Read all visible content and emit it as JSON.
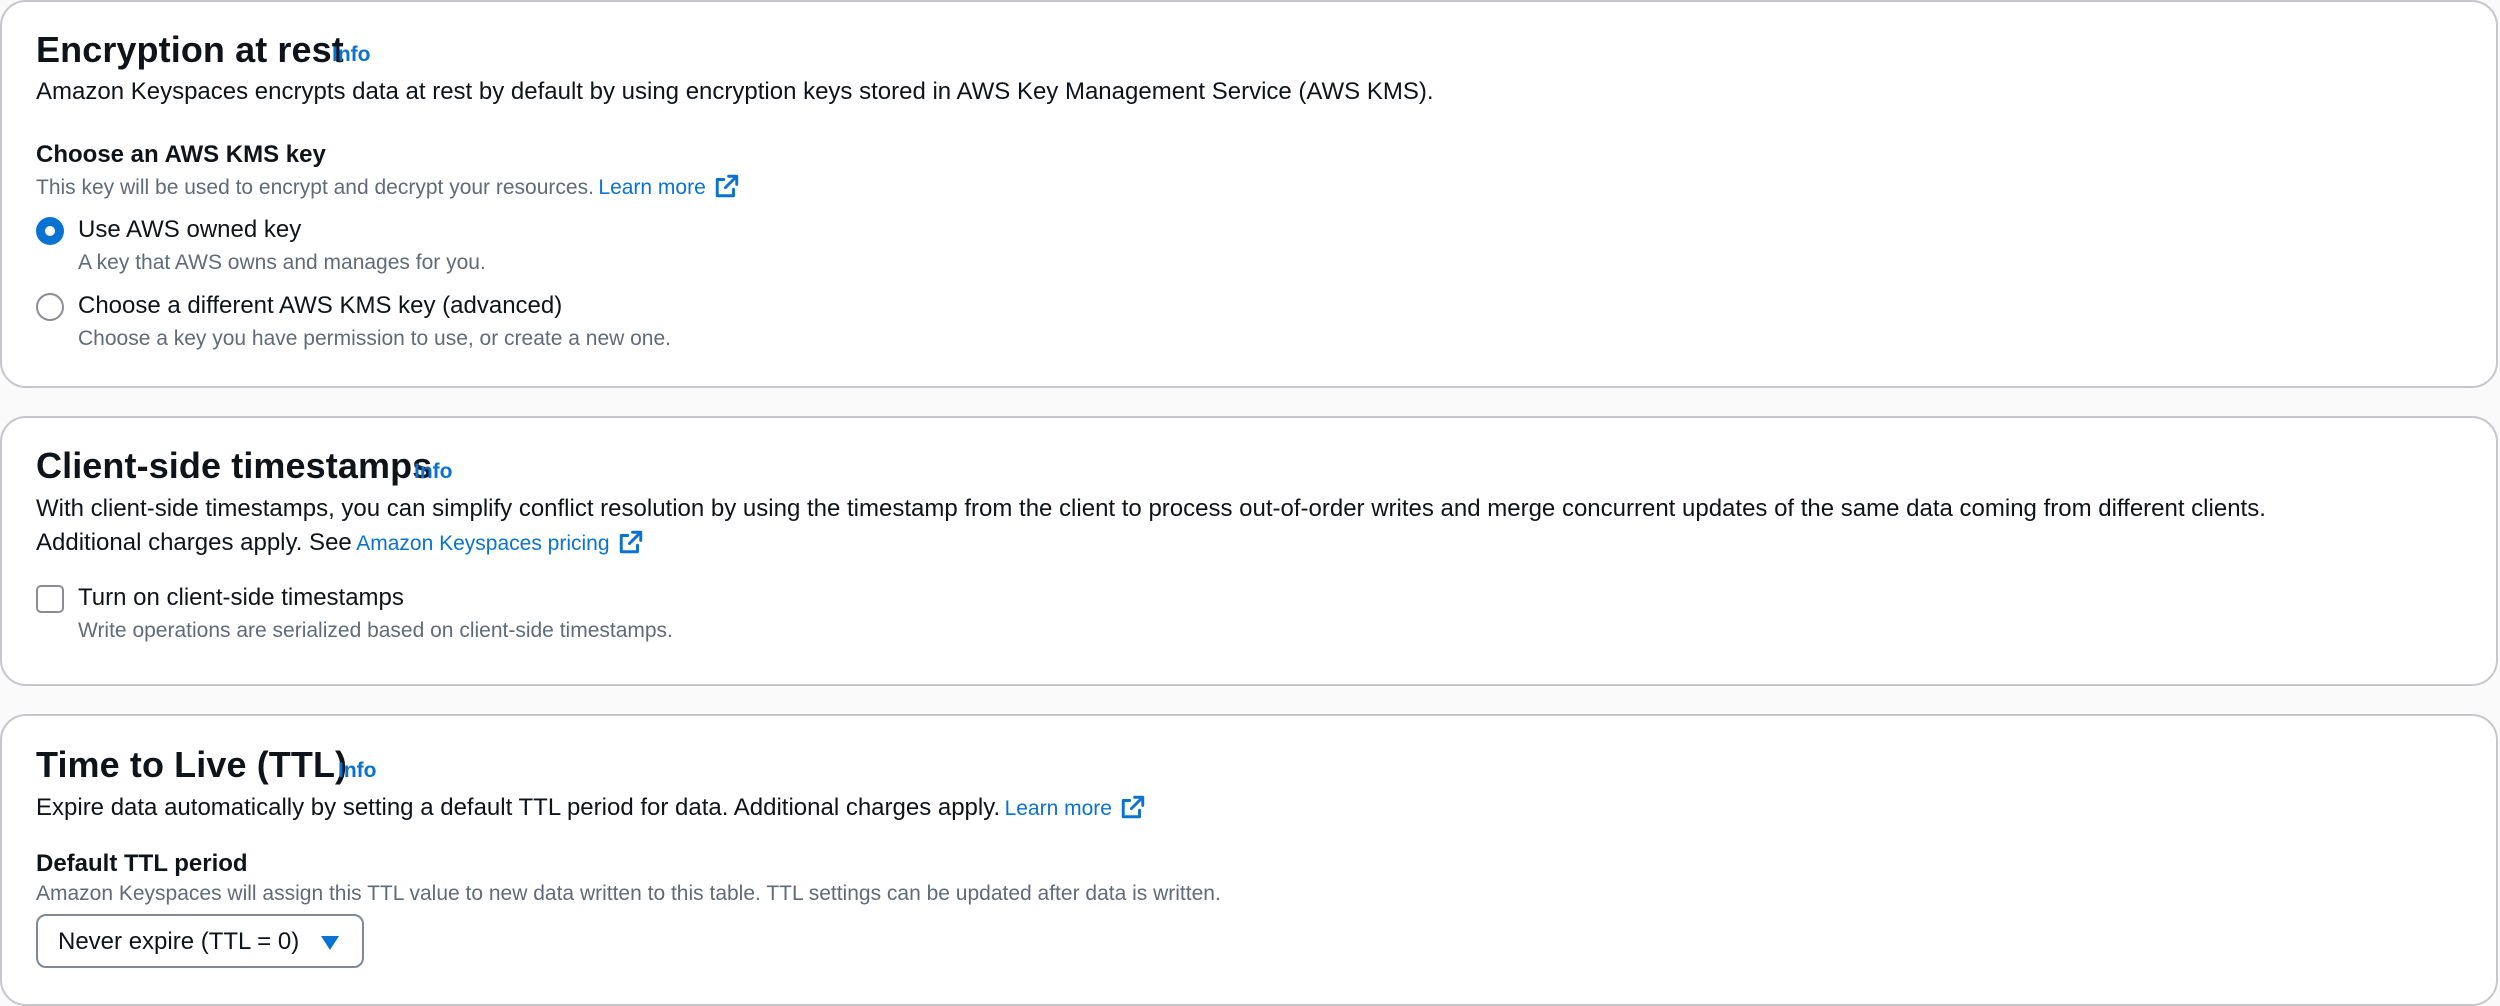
{
  "encryption": {
    "title": "Encryption at rest",
    "info": "Info",
    "description": "Amazon Keyspaces encrypts data at rest by default by using encryption keys stored in AWS Key Management Service (AWS KMS).",
    "kms_label": "Choose an AWS KMS key",
    "kms_desc": "This key will be used to encrypt and decrypt your resources.",
    "learn_more": "Learn more",
    "options": [
      {
        "label": "Use AWS owned key",
        "desc": "A key that AWS owns and manages for you.",
        "selected": true
      },
      {
        "label": "Choose a different AWS KMS key (advanced)",
        "desc": "Choose a key you have permission to use, or create a new one.",
        "selected": false
      }
    ]
  },
  "timestamps": {
    "title": "Client-side timestamps",
    "info": "Info",
    "description": "With client-side timestamps, you can simplify conflict resolution by using the timestamp from the client to process out-of-order writes and merge concurrent updates of the same data coming from different clients.",
    "charges_prefix": "Additional charges apply. See",
    "pricing_link": "Amazon Keyspaces pricing",
    "checkbox_label": "Turn on client-side timestamps",
    "checkbox_desc": "Write operations are serialized based on client-side timestamps.",
    "checked": false
  },
  "ttl": {
    "title": "Time to Live (TTL)",
    "info": "Info",
    "description": "Expire data automatically by setting a default TTL period for data. Additional charges apply.",
    "learn_more": "Learn more",
    "period_label": "Default TTL period",
    "period_desc": "Amazon Keyspaces will assign this TTL value to new data written to this table. TTL settings can be updated after data is written.",
    "select_value": "Never expire (TTL = 0)"
  },
  "colors": {
    "link": "#0972d3",
    "text": "#0f141a",
    "secondary_text": "#5f6b7a",
    "border": "#c6c6cd"
  },
  "icons": {
    "external_link": "external-link-icon",
    "dropdown": "caret-down-icon"
  }
}
